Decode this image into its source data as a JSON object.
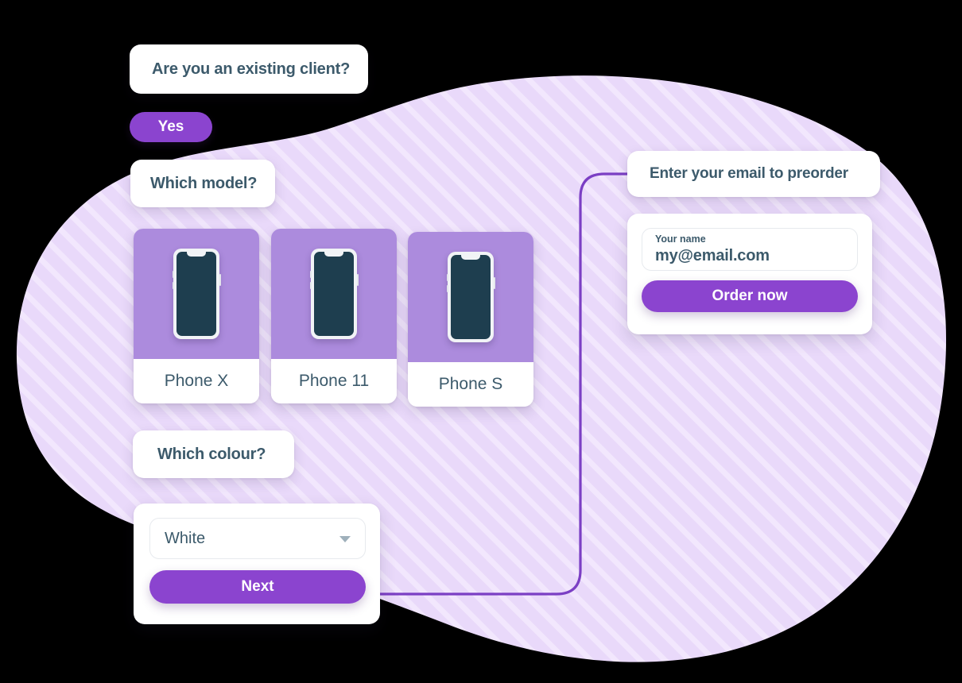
{
  "theme": {
    "accent_purple": "#8b44cf",
    "blob_fill": "#e9d9fa",
    "blob_stripe": "#f1e6fc",
    "card_lavender": "#ac8bdd",
    "text_slate": "#3c5a6b",
    "phone_screen": "#1e3e4f",
    "connector": "#7b3fc4",
    "canvas": "#000000"
  },
  "flow": {
    "question_existing_client": "Are you an existing client?",
    "answer_yes": "Yes",
    "question_which_model": "Which model?",
    "question_which_colour": "Which colour?",
    "phone_options": [
      {
        "label": "Phone X",
        "icon": "phone-mockup-icon"
      },
      {
        "label": "Phone 11",
        "icon": "phone-mockup-icon"
      },
      {
        "label": "Phone S",
        "icon": "phone-mockup-icon"
      }
    ],
    "colour_select": {
      "value": "White",
      "caret_icon": "chevron-down-icon"
    },
    "next_label": "Next"
  },
  "preorder": {
    "question_enter_email": "Enter your email to preorder",
    "email_field": {
      "label": "Your name",
      "value": "my@email.com",
      "placeholder": "my@email.com"
    },
    "order_now_label": "Order now"
  }
}
